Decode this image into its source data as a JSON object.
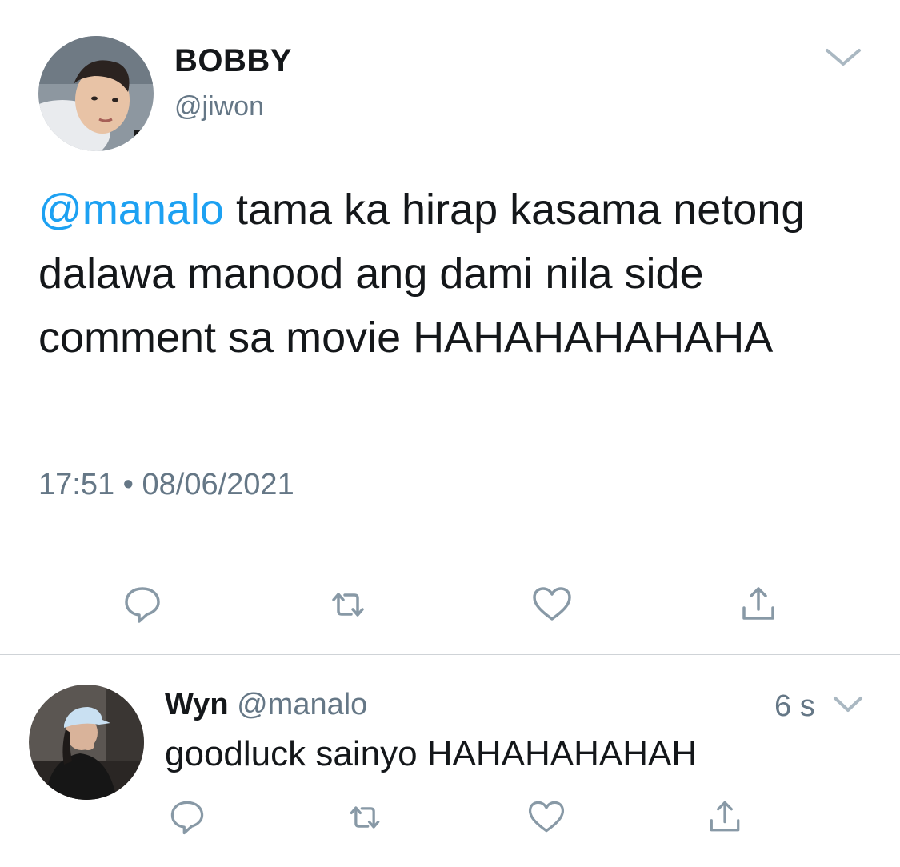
{
  "main_tweet": {
    "display_name": "BOBBY",
    "handle": "@jiwon",
    "mention": "@manalo",
    "text": " tama ka hirap kasama netong dalawa manood ang dami nila side comment sa movie HAHAHAHAHAHA",
    "time": "17:51",
    "separator": " • ",
    "date": "08/06/2021",
    "menu_icon": "chevron-down-icon",
    "actions": [
      "reply-icon",
      "retweet-icon",
      "like-icon",
      "share-icon"
    ]
  },
  "reply_tweet": {
    "display_name": "Wyn",
    "handle": "@manalo",
    "age": "6 s",
    "text": "goodluck sainyo HAHAHAHAHAH",
    "menu_icon": "chevron-down-icon",
    "actions": [
      "reply-icon",
      "retweet-icon",
      "like-icon",
      "share-icon"
    ]
  },
  "colors": {
    "text": "#14171a",
    "secondary": "#657786",
    "link": "#1da1f2",
    "icon": "#8899a6",
    "divider": "#d9dde1"
  }
}
